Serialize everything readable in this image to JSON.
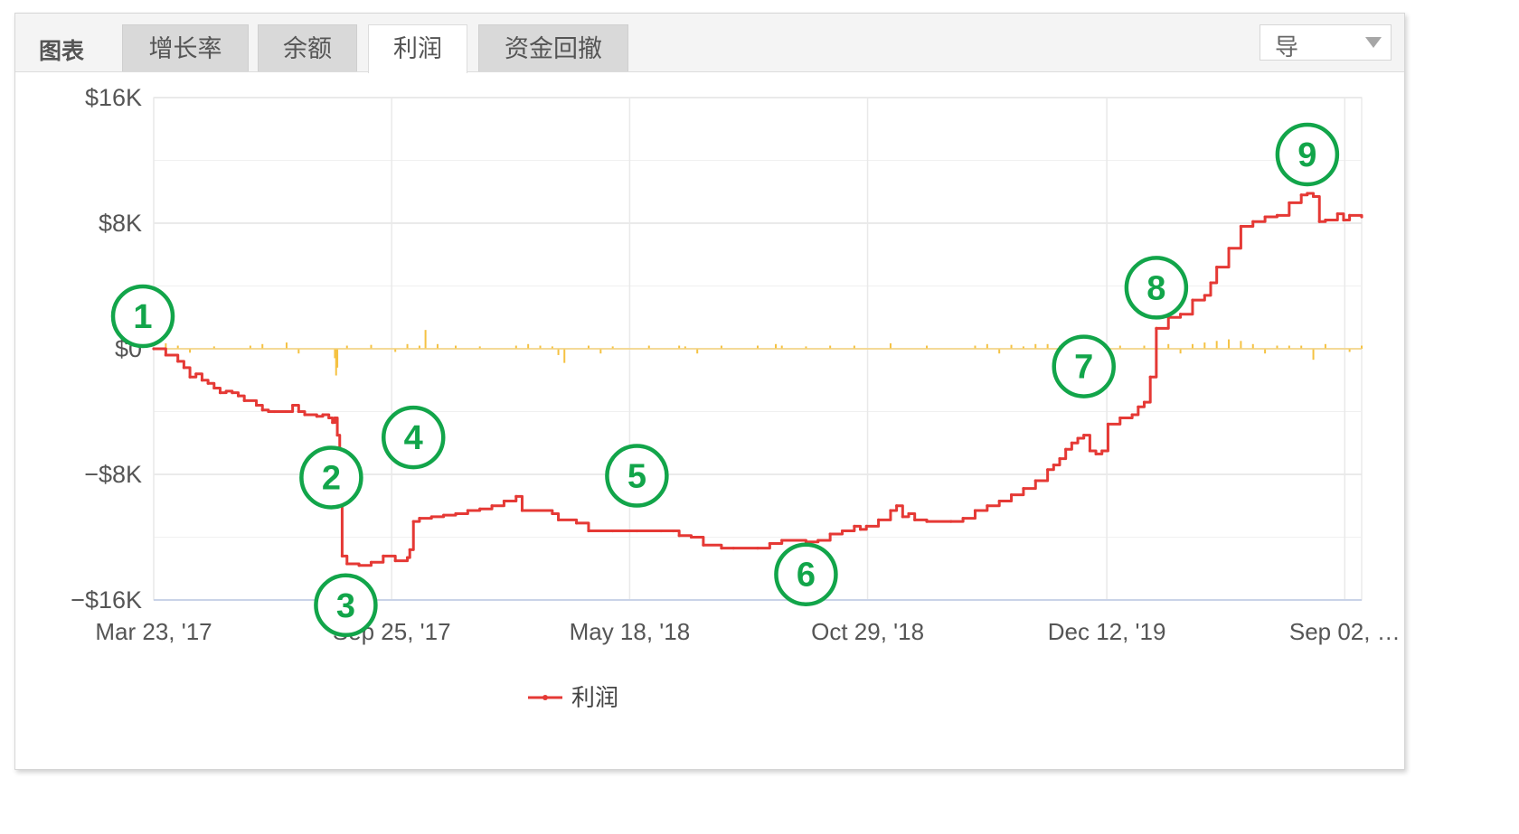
{
  "tabbar": {
    "title": "图表",
    "tabs": [
      {
        "label": "增长率",
        "active": false
      },
      {
        "label": "余额",
        "active": false
      },
      {
        "label": "利润",
        "active": true
      },
      {
        "label": "资金回撤",
        "active": false
      }
    ],
    "dropdown": {
      "label": "导"
    }
  },
  "colors": {
    "profit_line": "#e53935",
    "volume_bars": "#f5c242",
    "markers": "#12a54a",
    "grid": "#e8e8e8"
  },
  "chart_data": {
    "type": "line",
    "ylim": [
      -16000,
      16000
    ],
    "y_ticks": [
      16000,
      8000,
      0,
      -8000,
      -16000
    ],
    "y_tick_labels": [
      "$16K",
      "$8K",
      "$0",
      "−$8K",
      "−$16K"
    ],
    "x_tick_labels": [
      "Mar 23, '17",
      "Sep 25, '17",
      "May 18, '18",
      "Oct 29, '18",
      "Dec 12, '19",
      "Sep 02, …"
    ],
    "legend": [
      "利润"
    ],
    "series": [
      {
        "name": "利润",
        "points": [
          [
            0.0,
            0
          ],
          [
            0.01,
            -400
          ],
          [
            0.02,
            -800
          ],
          [
            0.025,
            -1200
          ],
          [
            0.03,
            -1800
          ],
          [
            0.035,
            -1600
          ],
          [
            0.04,
            -2000
          ],
          [
            0.045,
            -2200
          ],
          [
            0.05,
            -2500
          ],
          [
            0.055,
            -2800
          ],
          [
            0.06,
            -2700
          ],
          [
            0.065,
            -2800
          ],
          [
            0.07,
            -3000
          ],
          [
            0.075,
            -3300
          ],
          [
            0.085,
            -3600
          ],
          [
            0.09,
            -3900
          ],
          [
            0.095,
            -4000
          ],
          [
            0.1,
            -4000
          ],
          [
            0.11,
            -4000
          ],
          [
            0.115,
            -3600
          ],
          [
            0.12,
            -4000
          ],
          [
            0.125,
            -4200
          ],
          [
            0.135,
            -4300
          ],
          [
            0.14,
            -4200
          ],
          [
            0.145,
            -4400
          ],
          [
            0.148,
            -4700
          ],
          [
            0.15,
            -4400
          ],
          [
            0.152,
            -5500
          ],
          [
            0.154,
            -9000
          ],
          [
            0.156,
            -13200
          ],
          [
            0.16,
            -13700
          ],
          [
            0.17,
            -13800
          ],
          [
            0.18,
            -13600
          ],
          [
            0.19,
            -13200
          ],
          [
            0.2,
            -13500
          ],
          [
            0.21,
            -13300
          ],
          [
            0.212,
            -12800
          ],
          [
            0.215,
            -11000
          ],
          [
            0.22,
            -10800
          ],
          [
            0.23,
            -10700
          ],
          [
            0.24,
            -10600
          ],
          [
            0.25,
            -10500
          ],
          [
            0.26,
            -10300
          ],
          [
            0.27,
            -10200
          ],
          [
            0.28,
            -10000
          ],
          [
            0.29,
            -9700
          ],
          [
            0.3,
            -9400
          ],
          [
            0.305,
            -10300
          ],
          [
            0.33,
            -10500
          ],
          [
            0.335,
            -10900
          ],
          [
            0.35,
            -11100
          ],
          [
            0.36,
            -11600
          ],
          [
            0.38,
            -11600
          ],
          [
            0.4,
            -11600
          ],
          [
            0.42,
            -11600
          ],
          [
            0.43,
            -11600
          ],
          [
            0.435,
            -11900
          ],
          [
            0.445,
            -12000
          ],
          [
            0.455,
            -12500
          ],
          [
            0.47,
            -12700
          ],
          [
            0.48,
            -12700
          ],
          [
            0.5,
            -12700
          ],
          [
            0.51,
            -12400
          ],
          [
            0.52,
            -12200
          ],
          [
            0.54,
            -12300
          ],
          [
            0.55,
            -12200
          ],
          [
            0.56,
            -11800
          ],
          [
            0.57,
            -11600
          ],
          [
            0.58,
            -11300
          ],
          [
            0.585,
            -11500
          ],
          [
            0.59,
            -11300
          ],
          [
            0.6,
            -10900
          ],
          [
            0.61,
            -10300
          ],
          [
            0.615,
            -10000
          ],
          [
            0.62,
            -10700
          ],
          [
            0.625,
            -10500
          ],
          [
            0.63,
            -10900
          ],
          [
            0.64,
            -11000
          ],
          [
            0.66,
            -11000
          ],
          [
            0.67,
            -10800
          ],
          [
            0.68,
            -10300
          ],
          [
            0.69,
            -10000
          ],
          [
            0.7,
            -9700
          ],
          [
            0.71,
            -9300
          ],
          [
            0.72,
            -8900
          ],
          [
            0.73,
            -8400
          ],
          [
            0.74,
            -7700
          ],
          [
            0.745,
            -7400
          ],
          [
            0.75,
            -7000
          ],
          [
            0.755,
            -6400
          ],
          [
            0.76,
            -6000
          ],
          [
            0.765,
            -5700
          ],
          [
            0.77,
            -5500
          ],
          [
            0.775,
            -6500
          ],
          [
            0.78,
            -6700
          ],
          [
            0.785,
            -6500
          ],
          [
            0.79,
            -4800
          ],
          [
            0.8,
            -4400
          ],
          [
            0.81,
            -4200
          ],
          [
            0.815,
            -3700
          ],
          [
            0.82,
            -3400
          ],
          [
            0.825,
            -1800
          ],
          [
            0.83,
            1300
          ],
          [
            0.84,
            2000
          ],
          [
            0.85,
            2200
          ],
          [
            0.86,
            3100
          ],
          [
            0.87,
            3400
          ],
          [
            0.875,
            4200
          ],
          [
            0.88,
            5200
          ],
          [
            0.89,
            6400
          ],
          [
            0.9,
            7800
          ],
          [
            0.91,
            8100
          ],
          [
            0.92,
            8400
          ],
          [
            0.93,
            8500
          ],
          [
            0.94,
            9300
          ],
          [
            0.95,
            9800
          ],
          [
            0.955,
            9900
          ],
          [
            0.96,
            9700
          ],
          [
            0.965,
            8100
          ],
          [
            0.97,
            8200
          ],
          [
            0.98,
            8600
          ],
          [
            0.985,
            8200
          ],
          [
            0.99,
            8500
          ],
          [
            1.0,
            8400
          ]
        ]
      },
      {
        "name": "",
        "type": "bar",
        "points": [
          [
            0.01,
            350
          ],
          [
            0.02,
            200
          ],
          [
            0.03,
            -250
          ],
          [
            0.05,
            150
          ],
          [
            0.08,
            200
          ],
          [
            0.09,
            300
          ],
          [
            0.11,
            400
          ],
          [
            0.12,
            -300
          ],
          [
            0.15,
            -600
          ],
          [
            0.151,
            -1700
          ],
          [
            0.152,
            -1200
          ],
          [
            0.16,
            200
          ],
          [
            0.18,
            250
          ],
          [
            0.2,
            -200
          ],
          [
            0.21,
            300
          ],
          [
            0.22,
            200
          ],
          [
            0.225,
            1200
          ],
          [
            0.235,
            300
          ],
          [
            0.25,
            200
          ],
          [
            0.27,
            150
          ],
          [
            0.3,
            200
          ],
          [
            0.31,
            300
          ],
          [
            0.32,
            200
          ],
          [
            0.33,
            150
          ],
          [
            0.335,
            -400
          ],
          [
            0.34,
            -900
          ],
          [
            0.36,
            200
          ],
          [
            0.37,
            -300
          ],
          [
            0.38,
            150
          ],
          [
            0.41,
            200
          ],
          [
            0.435,
            200
          ],
          [
            0.44,
            150
          ],
          [
            0.45,
            -300
          ],
          [
            0.47,
            200
          ],
          [
            0.5,
            200
          ],
          [
            0.515,
            300
          ],
          [
            0.515,
            250
          ],
          [
            0.52,
            200
          ],
          [
            0.54,
            150
          ],
          [
            0.56,
            200
          ],
          [
            0.58,
            200
          ],
          [
            0.61,
            350
          ],
          [
            0.64,
            200
          ],
          [
            0.68,
            200
          ],
          [
            0.69,
            300
          ],
          [
            0.7,
            -300
          ],
          [
            0.71,
            250
          ],
          [
            0.72,
            150
          ],
          [
            0.73,
            300
          ],
          [
            0.74,
            300
          ],
          [
            0.75,
            200
          ],
          [
            0.77,
            150
          ],
          [
            0.78,
            -400
          ],
          [
            0.8,
            200
          ],
          [
            0.82,
            200
          ],
          [
            0.83,
            1400
          ],
          [
            0.84,
            300
          ],
          [
            0.85,
            -300
          ],
          [
            0.86,
            300
          ],
          [
            0.87,
            400
          ],
          [
            0.88,
            500
          ],
          [
            0.89,
            600
          ],
          [
            0.9,
            500
          ],
          [
            0.91,
            300
          ],
          [
            0.92,
            -300
          ],
          [
            0.93,
            200
          ],
          [
            0.94,
            200
          ],
          [
            0.95,
            200
          ],
          [
            0.96,
            -700
          ],
          [
            0.97,
            300
          ],
          [
            0.99,
            -200
          ],
          [
            1.0,
            200
          ]
        ]
      }
    ],
    "annotations": [
      {
        "label": "1",
        "x": 0.0,
        "y": 0
      },
      {
        "label": "2",
        "x": 0.15,
        "y": -4400
      },
      {
        "label": "3",
        "x": 0.156,
        "y": -13800
      },
      {
        "label": "4",
        "x": 0.215,
        "y": -11000
      },
      {
        "label": "5",
        "x": 0.4,
        "y": -11600
      },
      {
        "label": "6",
        "x": 0.54,
        "y": -12300
      },
      {
        "label": "7",
        "x": 0.77,
        "y": -5500
      },
      {
        "label": "8",
        "x": 0.83,
        "y": 1300
      },
      {
        "label": "9",
        "x": 0.955,
        "y": 9900
      }
    ]
  }
}
